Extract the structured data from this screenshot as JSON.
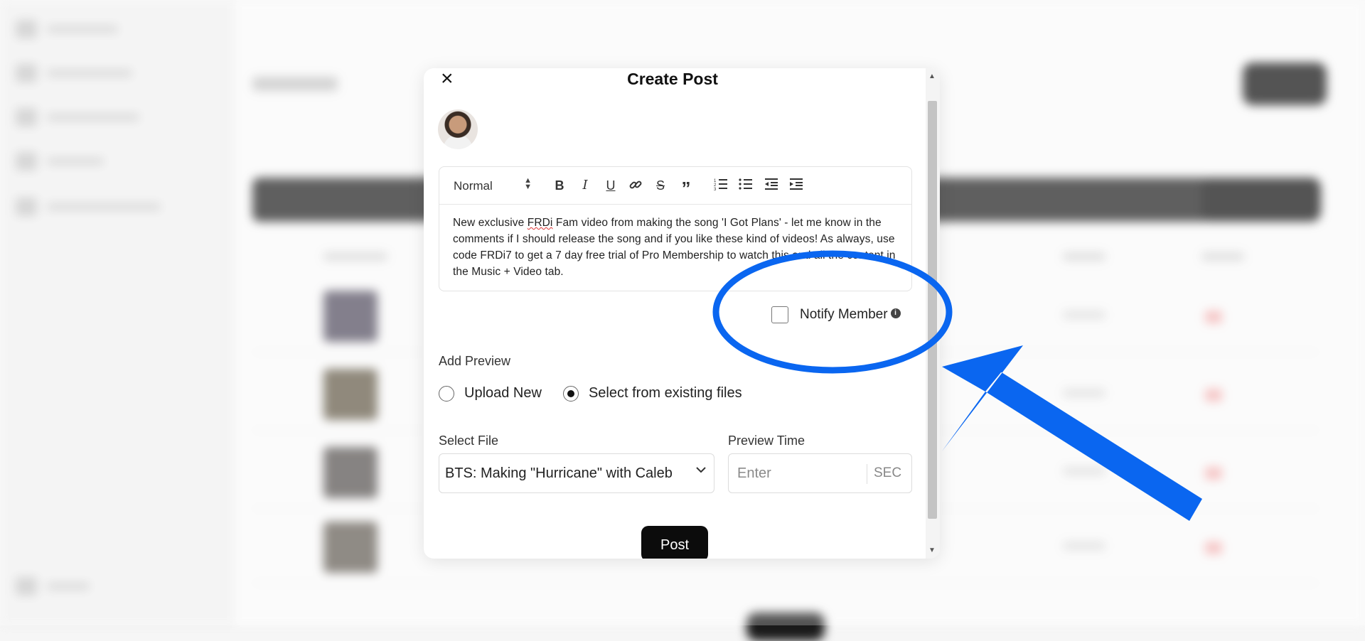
{
  "modal": {
    "title": "Create Post",
    "close_icon": "×",
    "editor": {
      "format_select": "Normal",
      "toolbar_icons": [
        "bold-icon",
        "italic-icon",
        "underline-icon",
        "link-icon",
        "strike-icon",
        "quote-icon",
        "ordered-list-icon",
        "bullet-list-icon",
        "outdent-icon",
        "indent-icon"
      ],
      "content_part1": "New exclusive ",
      "content_misspelled": "FRDi",
      "content_part2": " Fam video from making the song 'I Got Plans' - let me know in the comments if I should release the song and if you like these kind of videos! As always, use code FRDi7 to get a 7 day free trial of Pro Membership to watch this and all the content in the Music + Video tab."
    },
    "notify_member_label": "Notify Member",
    "add_preview_label": "Add Preview",
    "radio_upload_new": "Upload New",
    "radio_select_existing": "Select from existing files",
    "selected_radio": "Select from existing files",
    "select_file_label": "Select File",
    "select_file_value": "BTS: Making \"Hurricane\" with Caleb",
    "preview_time_label": "Preview Time",
    "preview_time_placeholder": "Enter",
    "preview_time_unit": "SEC",
    "post_button": "Post"
  },
  "annotation": {
    "color": "#0a66f0",
    "shapes": [
      "ellipse-highlight",
      "arrow-pointer"
    ]
  }
}
